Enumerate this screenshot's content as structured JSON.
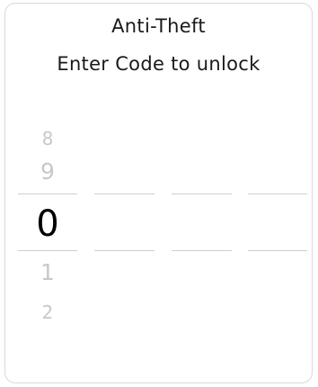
{
  "header": {
    "title": "Anti-Theft",
    "subtitle": "Enter Code to unlock"
  },
  "code_picker": {
    "selected_wheel": 0,
    "wheels": [
      {
        "above_far": "8",
        "above": "9",
        "selected": "0",
        "below": "1",
        "below_far": "2"
      },
      {
        "above_far": "",
        "above": "",
        "selected": "",
        "below": "",
        "below_far": ""
      },
      {
        "above_far": "",
        "above": "",
        "selected": "",
        "below": "",
        "below_far": ""
      },
      {
        "above_far": "",
        "above": "",
        "selected": "",
        "below": "",
        "below_far": ""
      }
    ]
  },
  "colors": {
    "selected_digit": "#000000",
    "faded_digit": "#c8c8c8",
    "separator": "#cfcfcf",
    "border": "#d9d9d9"
  }
}
